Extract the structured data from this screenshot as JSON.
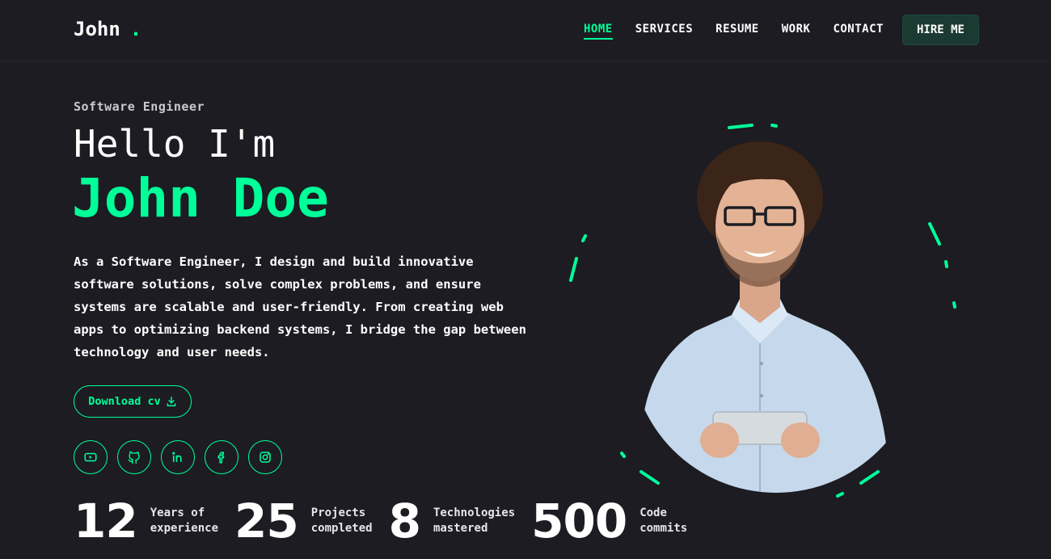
{
  "header": {
    "logo": "John",
    "logo_dot": ".",
    "nav": [
      "HOME",
      "SERVICES",
      "RESUME",
      "WORK",
      "CONTACT"
    ],
    "hire_label": "HIRE ME"
  },
  "hero": {
    "role": "Software Engineer",
    "greeting": "Hello I'm",
    "name": "John Doe",
    "bio": "As a Software Engineer, I design and build innovative software solutions, solve complex problems, and ensure systems are scalable and user-friendly. From creating web apps to optimizing backend systems, I bridge the gap between technology and user needs.",
    "download_label": "Download cv"
  },
  "socials": [
    "youtube-icon",
    "github-icon",
    "linkedin-icon",
    "facebook-icon",
    "instagram-icon"
  ],
  "stats": [
    {
      "value": "12",
      "line1": "Years of",
      "line2": "experience"
    },
    {
      "value": "25",
      "line1": "Projects",
      "line2": "completed"
    },
    {
      "value": "8",
      "line1": "Technologies",
      "line2": "mastered"
    },
    {
      "value": "500",
      "line1": "Code",
      "line2": "commits"
    }
  ],
  "colors": {
    "background": "#1c1c22",
    "accent": "#00ff99",
    "hire_bg": "#1b3a31"
  }
}
